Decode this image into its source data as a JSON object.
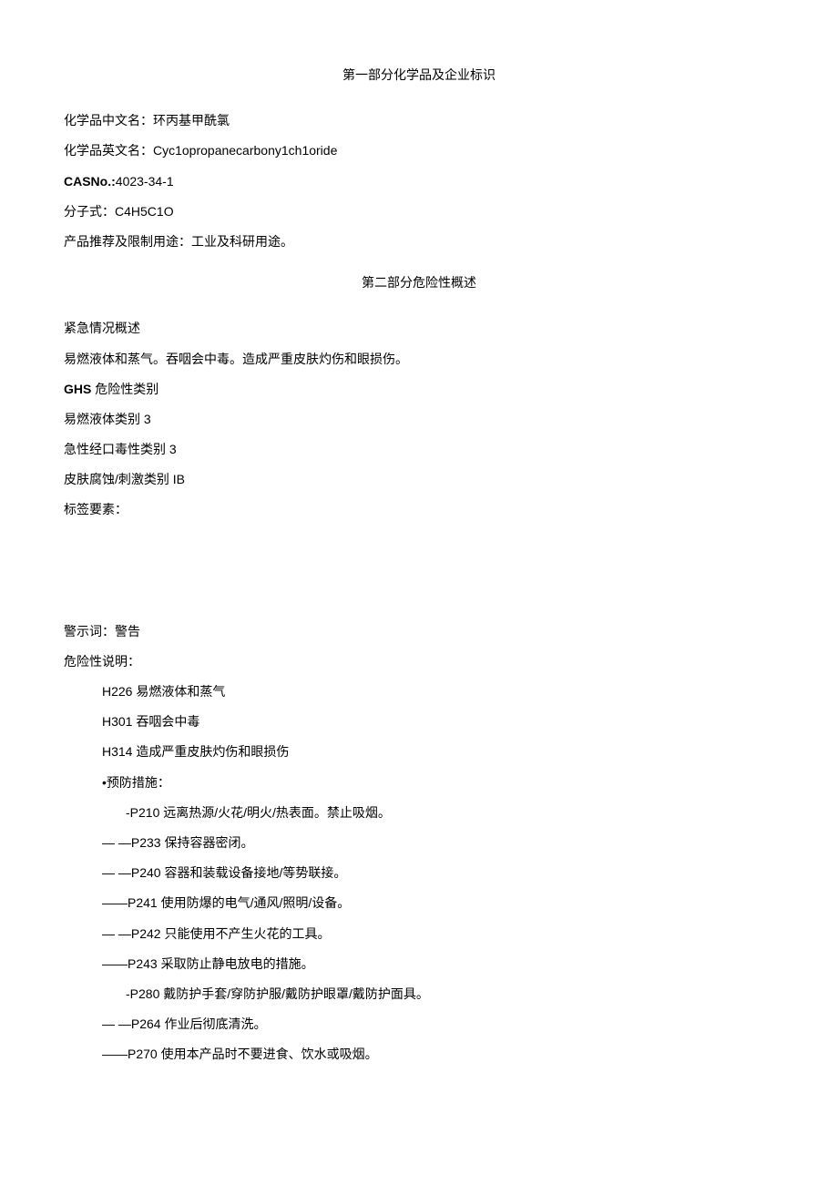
{
  "section1": {
    "title": "第一部分化学品及企业标识",
    "chinese_name_label": "化学品中文名：",
    "chinese_name": "环丙基甲酰氯",
    "english_name_label": "化学品英文名：",
    "english_name": "Cyc1opropanecarbony1ch1oride",
    "cas_label": "CASNo.:",
    "cas_no": "4023-34-1",
    "formula_label": "分子式：",
    "formula": "C4H5C1O",
    "usage_label": "产品推荐及限制用途：",
    "usage": "工业及科研用途。"
  },
  "section2": {
    "title": "第二部分危险性概述",
    "emergency_label": "紧急情况概述",
    "emergency_desc": "易燃液体和蒸气。吞咽会中毒。造成严重皮肤灼伤和眼损伤。",
    "ghs_label": "GHS",
    "ghs_label2": " 危险性类别",
    "ghs_cat1": "易燃液体类别 3",
    "ghs_cat2": "急性经口毒性类别 3",
    "ghs_cat3": "皮肤腐蚀/刺激类别 IB",
    "label_elements": "标签要素：",
    "signal_word_label": "警示词：",
    "signal_word": "警告",
    "hazard_label": "危险性说明：",
    "h226": "H226 易燃液体和蒸气",
    "h301": "H301 吞咽会中毒",
    "h314": "H314 造成严重皮肤灼伤和眼损伤",
    "prevention_label": "•预防措施：",
    "p210": "-P210 远离热源/火花/明火/热表面。禁止吸烟。",
    "p233": "—   —P233 保持容器密闭。",
    "p240": "—   —P240 容器和装载设备接地/等势联接。",
    "p241": "——P241 使用防爆的电气/通风/照明/设备。",
    "p242": "—   —P242 只能使用不产生火花的工具。",
    "p243": "——P243 采取防止静电放电的措施。",
    "p280": "-P280 戴防护手套/穿防护服/戴防护眼罩/戴防护面具。",
    "p264": "—   —P264 作业后彻底清洗。",
    "p270": "——P270 使用本产品时不要进食、饮水或吸烟。"
  }
}
